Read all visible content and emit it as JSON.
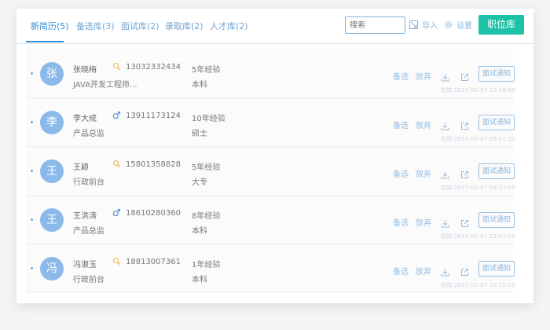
{
  "tabs": [
    {
      "label": "新简历(5)",
      "active": true
    },
    {
      "label": "备选库(3)",
      "active": false
    },
    {
      "label": "面试库(2)",
      "active": false
    },
    {
      "label": "录取库(2)",
      "active": false
    },
    {
      "label": "人才库(2)",
      "active": false
    }
  ],
  "toolbar": {
    "search_placeholder": "搜索",
    "import_label": "导入",
    "settings_label": "设置",
    "primary_button": "职位库"
  },
  "row_actions": {
    "shortlist": "备选",
    "discard": "放弃",
    "notify": "面试通知"
  },
  "candidates": [
    {
      "avatar": "张",
      "name": "张晓梅",
      "gender": "female",
      "phone": "13032332434",
      "role": "JAVA开发工程师...",
      "experience": "5年经验",
      "education": "本科",
      "meta": "拉钩  2017-02-07  10:18:03"
    },
    {
      "avatar": "李",
      "name": "李大成",
      "gender": "male",
      "phone": "13911173124",
      "role": "产品总监",
      "experience": "10年经验",
      "education": "硕士",
      "meta": "拉钩  2017-02-07  09:51:30"
    },
    {
      "avatar": "王",
      "name": "王颖",
      "gender": "female",
      "phone": "15801358828",
      "role": "行政前台",
      "experience": "5年经验",
      "education": "大专",
      "meta": "拉钩  2017-02-07  09:37:09"
    },
    {
      "avatar": "王",
      "name": "王洪涛",
      "gender": "male",
      "phone": "18610280360",
      "role": "产品总监",
      "experience": "8年经验",
      "education": "本科",
      "meta": "拉钩  2017-02-07  22:57:05"
    },
    {
      "avatar": "冯",
      "name": "冯淑玉",
      "gender": "female",
      "phone": "18813007361",
      "role": "行政前台",
      "experience": "1年经验",
      "education": "本科",
      "meta": "拉钩  2017-02-07  19:55:09"
    }
  ],
  "colors": {
    "accent": "#2e90da",
    "primary_button": "#1bc2a6",
    "avatar": "#8ab9ea",
    "female": "#f0b840",
    "male": "#4a8ad0"
  }
}
